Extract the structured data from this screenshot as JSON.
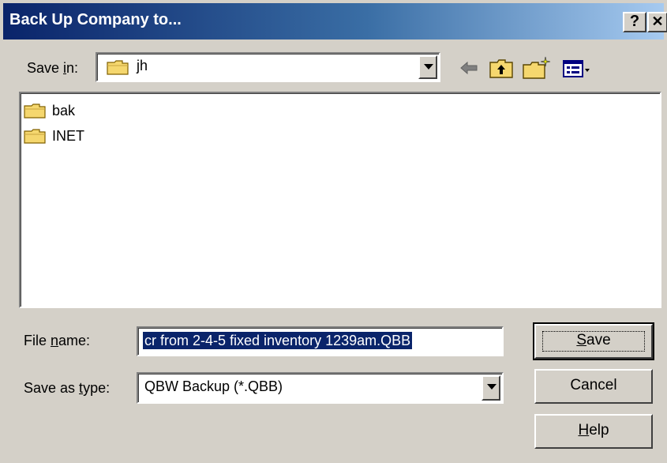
{
  "window": {
    "title": "Back Up Company to...",
    "help_glyph": "?",
    "close_glyph": "✕"
  },
  "save_in": {
    "label_pre": "Save ",
    "label_hotkey": "i",
    "label_post": "n:",
    "value": "jh",
    "icon": "folder-icon"
  },
  "toolbar": {
    "icons": [
      "back-arrow-icon",
      "up-folder-icon",
      "new-folder-icon",
      "view-menu-icon"
    ]
  },
  "files": [
    {
      "name": "bak",
      "icon": "folder-icon"
    },
    {
      "name": "INET",
      "icon": "folder-icon"
    }
  ],
  "file_name": {
    "label_pre": "File ",
    "label_hotkey": "n",
    "label_post": "ame:",
    "value": "cr from 2-4-5 fixed inventory 1239am.QBB"
  },
  "save_as_type": {
    "label_pre": "Save as ",
    "label_hotkey": "t",
    "label_post": "ype:",
    "value": "QBW Backup (*.QBB)"
  },
  "buttons": {
    "save": {
      "pre": "",
      "hotkey": "S",
      "post": "ave"
    },
    "cancel": {
      "label": "Cancel"
    },
    "help": {
      "pre": "",
      "hotkey": "H",
      "post": "elp"
    }
  },
  "colors": {
    "face": "#d4d0c8",
    "title_start": "#0a246a",
    "title_end": "#a6caf0",
    "selection": "#0a246a",
    "folder": "#f5d76e"
  }
}
